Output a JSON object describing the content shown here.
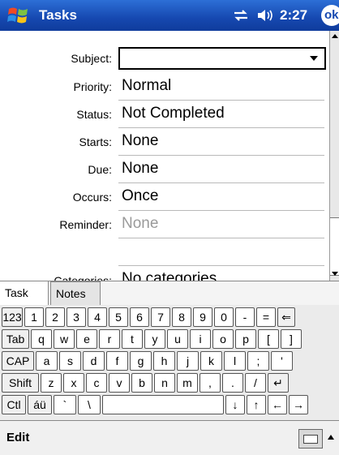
{
  "titlebar": {
    "app_title": "Tasks",
    "time": "2:27",
    "ok_label": "ok",
    "start_icon": "windows-flag-icon",
    "connectivity_icon": "connectivity-icon",
    "volume_icon": "speaker-icon"
  },
  "form": {
    "subject": {
      "label": "Subject:",
      "value": ""
    },
    "priority": {
      "label": "Priority:",
      "value": "Normal"
    },
    "status": {
      "label": "Status:",
      "value": "Not Completed"
    },
    "starts": {
      "label": "Starts:",
      "value": "None"
    },
    "due": {
      "label": "Due:",
      "value": "None"
    },
    "occurs": {
      "label": "Occurs:",
      "value": "Once"
    },
    "reminder": {
      "label": "Reminder:",
      "value": "None"
    },
    "categories": {
      "label": "Categories:",
      "value": "No categories"
    }
  },
  "tabs": [
    {
      "label": "Task"
    },
    {
      "label": "Notes"
    }
  ],
  "keyboard": {
    "row1": [
      "123",
      "1",
      "2",
      "3",
      "4",
      "5",
      "6",
      "7",
      "8",
      "9",
      "0",
      "-",
      "=",
      "⇐"
    ],
    "row2": [
      "Tab",
      "q",
      "w",
      "e",
      "r",
      "t",
      "y",
      "u",
      "i",
      "o",
      "p",
      "[",
      "]"
    ],
    "row3": [
      "CAP",
      "a",
      "s",
      "d",
      "f",
      "g",
      "h",
      "j",
      "k",
      "l",
      ";",
      "'"
    ],
    "row4": [
      "Shift",
      "z",
      "x",
      "c",
      "v",
      "b",
      "n",
      "m",
      ",",
      ".",
      "/",
      "↵"
    ],
    "row5": [
      "Ctl",
      "áü",
      "`",
      "\\",
      "",
      "↓",
      "↑",
      "←",
      "→"
    ]
  },
  "menubar": {
    "edit_label": "Edit",
    "input_icon": "keyboard-icon"
  },
  "colors": {
    "title_bar": "#1648b0",
    "keyboard_bg": "#ebebeb"
  }
}
